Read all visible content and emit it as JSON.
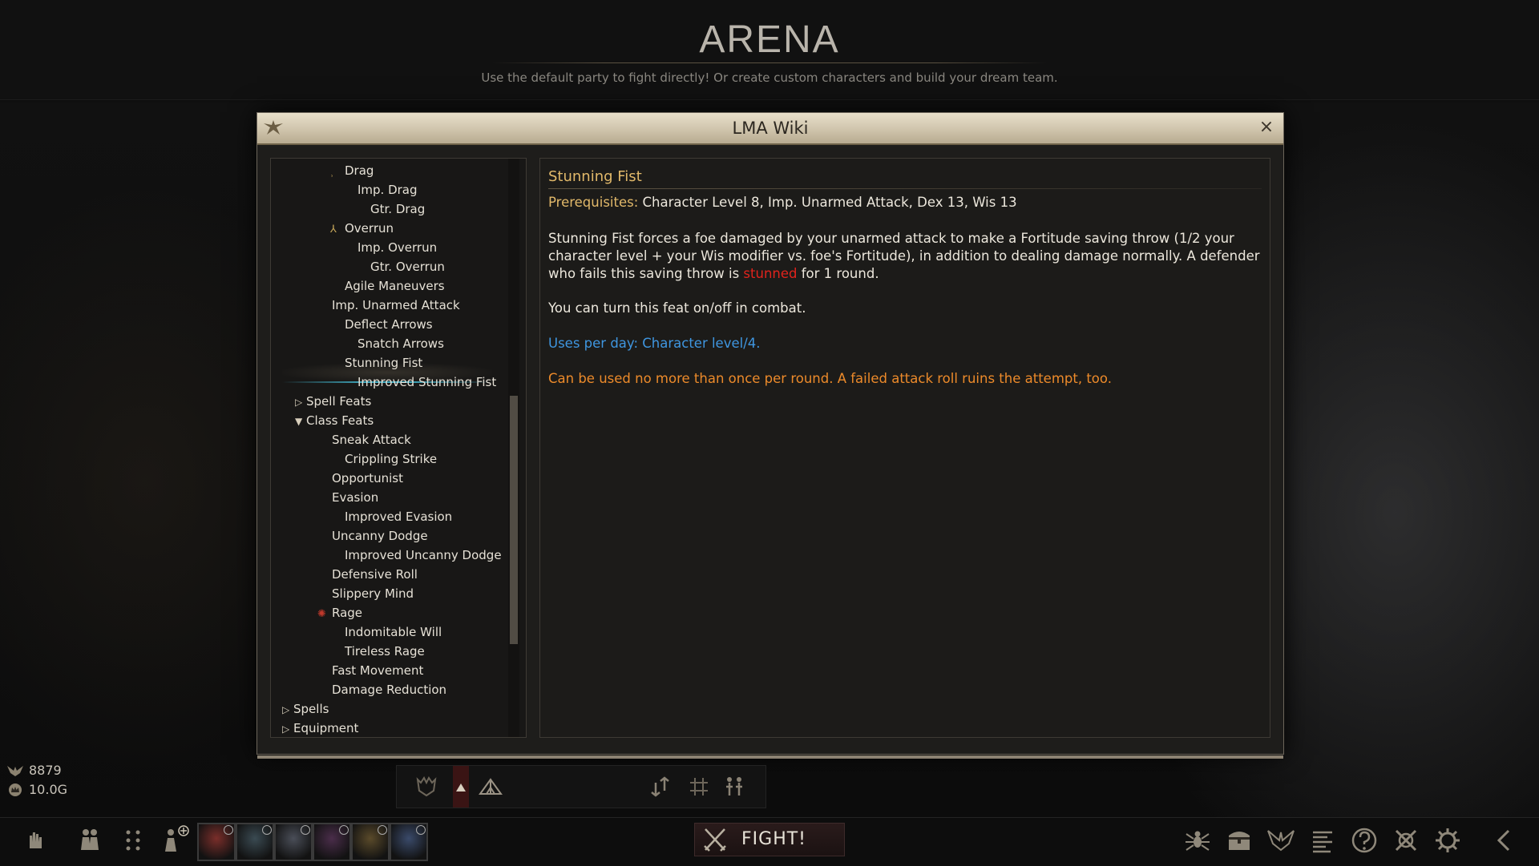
{
  "header": {
    "title": "ARENA",
    "subtitle": "Use the default party to fight directly! Or create custom characters and build your dream team."
  },
  "wiki": {
    "title": "LMA Wiki",
    "close": "×",
    "tree": [
      {
        "label": "Drag",
        "indent": 5,
        "icon": "drag-feat-icon",
        "glyph": "⸒"
      },
      {
        "label": "Imp. Drag",
        "indent": 6
      },
      {
        "label": "Gtr. Drag",
        "indent": 7
      },
      {
        "label": "Overrun",
        "indent": 5,
        "icon": "overrun-feat-icon",
        "glyph": "⅄"
      },
      {
        "label": "Imp. Overrun",
        "indent": 6
      },
      {
        "label": "Gtr. Overrun",
        "indent": 7
      },
      {
        "label": "Agile Maneuvers",
        "indent": 5
      },
      {
        "label": "Imp. Unarmed Attack",
        "indent": 4
      },
      {
        "label": "Deflect Arrows",
        "indent": 5
      },
      {
        "label": "Snatch Arrows",
        "indent": 6
      },
      {
        "label": "Stunning Fist",
        "indent": 5,
        "selected": true
      },
      {
        "label": "Improved Stunning Fist",
        "indent": 6
      },
      {
        "label": "Spell Feats",
        "indent": 2,
        "toggle": "▷"
      },
      {
        "label": "Class Feats",
        "indent": 2,
        "toggle": "▼"
      },
      {
        "label": "Sneak Attack",
        "indent": 4
      },
      {
        "label": "Crippling Strike",
        "indent": 5
      },
      {
        "label": "Opportunist",
        "indent": 4
      },
      {
        "label": "Evasion",
        "indent": 4
      },
      {
        "label": "Improved Evasion",
        "indent": 5
      },
      {
        "label": "Uncanny Dodge",
        "indent": 4
      },
      {
        "label": "Improved Uncanny Dodge",
        "indent": 5
      },
      {
        "label": "Defensive Roll",
        "indent": 4
      },
      {
        "label": "Slippery Mind",
        "indent": 4
      },
      {
        "label": "Rage",
        "indent": 4,
        "icon": "rage-feat-icon",
        "glyph": "✺",
        "iconColor": "#c0392b"
      },
      {
        "label": "Indomitable Will",
        "indent": 5
      },
      {
        "label": "Tireless Rage",
        "indent": 5
      },
      {
        "label": "Fast Movement",
        "indent": 4
      },
      {
        "label": "Damage Reduction",
        "indent": 4
      },
      {
        "label": "Spells",
        "indent": 1,
        "toggle": "▷"
      },
      {
        "label": "Equipment",
        "indent": 1,
        "toggle": "▷"
      }
    ],
    "content": {
      "title": "Stunning Fist",
      "prereq_label": "Prerequisites:",
      "prereq_text": "Character Level 8, Imp. Unarmed Attack, Dex 13, Wis 13",
      "body_before": "Stunning Fist forces a foe damaged by your unarmed attack to make a Fortitude saving throw (1/2 your character level + your Wis modifier vs. foe's Fortitude), in addition to dealing damage normally. A defender who fails this saving throw is ",
      "body_keyword": "stunned",
      "body_after": " for 1 round.",
      "toggle_note": "You can turn this feat on/off in combat.",
      "uses": "Uses per day: Character level/4.",
      "limit": "Can be used no more than once per round. A failed attack roll ruins the attempt, too."
    }
  },
  "resources": {
    "xp": "8879",
    "gold": "10.0G"
  },
  "bottom": {
    "fight_label": "FIGHT!",
    "party_count": 6
  },
  "colors": {
    "accent_gold": "#e2b96a",
    "keyword_red": "#e0231c",
    "uses_blue": "#3f96e0",
    "limit_orange": "#ec8a2a",
    "selection_cyan": "#3fa9bf"
  }
}
